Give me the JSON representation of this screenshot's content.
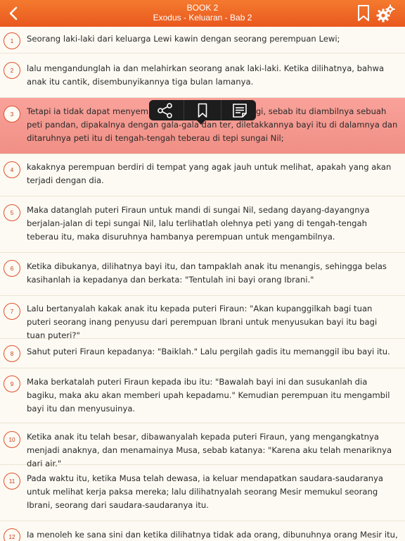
{
  "header": {
    "book": "BOOK 2",
    "subtitle": "Exodus - Keluaran - Bab 2",
    "back_icon": "chevron-left-icon",
    "bookmark_icon": "bookmark-icon",
    "settings_icon": "gear-icon",
    "color_top": "#f47a2e",
    "color_bottom": "#e9581f"
  },
  "popup": {
    "share_icon": "share-icon",
    "bookmark_icon": "bookmark-icon",
    "note_icon": "note-icon"
  },
  "verses": [
    {
      "num": "1",
      "text": "Seorang laki-laki dari keluarga Lewi kawin dengan seorang perempuan Lewi;"
    },
    {
      "num": "2",
      "text": "lalu mengandunglah ia dan melahirkan seorang anak laki-laki. Ketika dilihatnya, bahwa anak itu cantik, disembunyikannya tiga bulan lamanya."
    },
    {
      "num": "3",
      "text": "Tetapi ia tidak dapat menyembunyikannya lebih lama lagi, sebab itu diambilnya sebuah peti pandan, dipakalnya dengan gala-gala dan ter, diletakkannya bayi itu di dalamnya dan ditaruhnya peti itu di tengah-tengah teberau di tepi sungai Nil;"
    },
    {
      "num": "4",
      "text": "kakaknya perempuan berdiri di tempat yang agak jauh untuk melihat, apakah yang akan terjadi dengan dia."
    },
    {
      "num": "5",
      "text": "Maka datanglah puteri Firaun untuk mandi di sungai Nil, sedang dayang-dayangnya berjalan-jalan di tepi sungai Nil, lalu terlihatlah olehnya peti yang di tengah-tengah teberau itu, maka disuruhnya hambanya perempuan untuk mengambilnya."
    },
    {
      "num": "6",
      "text": "Ketika dibukanya, dilihatnya bayi itu, dan tampaklah anak itu menangis, sehingga belas kasihanlah ia kepadanya dan berkata: \"Tentulah ini bayi orang Ibrani.\""
    },
    {
      "num": "7",
      "text": "Lalu bertanyalah kakak anak itu kepada puteri Firaun: \"Akan kupanggilkah bagi tuan puteri seorang inang penyusu dari perempuan Ibrani untuk menyusukan bayi itu bagi tuan puteri?\""
    },
    {
      "num": "8",
      "text": "Sahut puteri Firaun kepadanya: \"Baiklah.\" Lalu pergilah gadis itu memanggil ibu bayi itu."
    },
    {
      "num": "9",
      "text": "Maka berkatalah puteri Firaun kepada ibu itu: \"Bawalah bayi ini dan susukanlah dia bagiku, maka aku akan memberi upah kepadamu.\" Kemudian perempuan itu mengambil bayi itu dan menyusuinya."
    },
    {
      "num": "10",
      "text": "Ketika anak itu telah besar, dibawanyalah kepada puteri Firaun, yang mengangkatnya menjadi anaknya, dan menamainya Musa, sebab katanya: \"Karena aku telah menariknya dari air.\""
    },
    {
      "num": "11",
      "text": "Pada waktu itu, ketika Musa telah dewasa, ia keluar mendapatkan saudara-saudaranya untuk melihat kerja paksa mereka; lalu dilihatnyalah seorang Mesir memukul seorang Ibrani, seorang dari saudara-saudaranya itu."
    },
    {
      "num": "12",
      "text": "Ia menoleh ke sana sini dan ketika dilihatnya tidak ada orang, dibunuhnya orang Mesir itu, dan"
    }
  ],
  "colors": {
    "accent": "#e0502c",
    "highlight": "#f59b91",
    "background": "#fdfaf3"
  }
}
